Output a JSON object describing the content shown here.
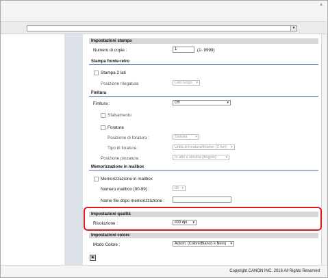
{
  "window": {
    "url_select_arrow": "▼",
    "corner_arrow": "▲"
  },
  "print_settings": {
    "header": "Impostazioni stampa",
    "copies_label": "Numero di copie :",
    "copies_value": "1",
    "copies_range": "(1- 9999)"
  },
  "duplex": {
    "header": "Stampa fronte-retro",
    "duplex_label": "Stampa 2 lati",
    "binding_label": "Posizione rilegatura",
    "binding_value": "Lato lungo"
  },
  "finishing": {
    "header": "Finitura",
    "finishing_label": "Finitura :",
    "finishing_value": "Off",
    "offset_label": "Sfalsamento",
    "punch_label": "Foratura",
    "punch_position_label": "Posizione di foratura :",
    "punch_position_value": "Sinistra",
    "punch_type_label": "Tipo di foratura :",
    "punch_type_value": "Unità di foratura/finisher (2 fori)",
    "staple_label": "Posizione pinzatura :",
    "staple_value": "In alto a sinistra (Angolo)"
  },
  "mailbox": {
    "header": "Memorizzazione in mailbox",
    "store_label": "Memorizzazione in mailbox",
    "number_label": "Numero mailbox (00-99) :",
    "number_value": "00",
    "filename_label": "Nome file dopo memorizzazione :",
    "filename_value": ""
  },
  "quality": {
    "header": "Impostazioni qualità",
    "resolution_label": "Risoluzione :",
    "resolution_value": "600 dpi"
  },
  "color": {
    "header": "Impostazioni colore",
    "mode_label": "Modo Colore :",
    "mode_value": "Autom. (Colore/Bianco e Nero)"
  },
  "expander_symbol": "▣",
  "dropdown_arrow": "▾",
  "footer": {
    "copyright": "Copyright CANON INC. 2016 All Rights Reserved"
  },
  "colors": {
    "highlight": "#e0141a",
    "section_band": "#d7d7d7",
    "nav_panel": "#dde2ea"
  }
}
